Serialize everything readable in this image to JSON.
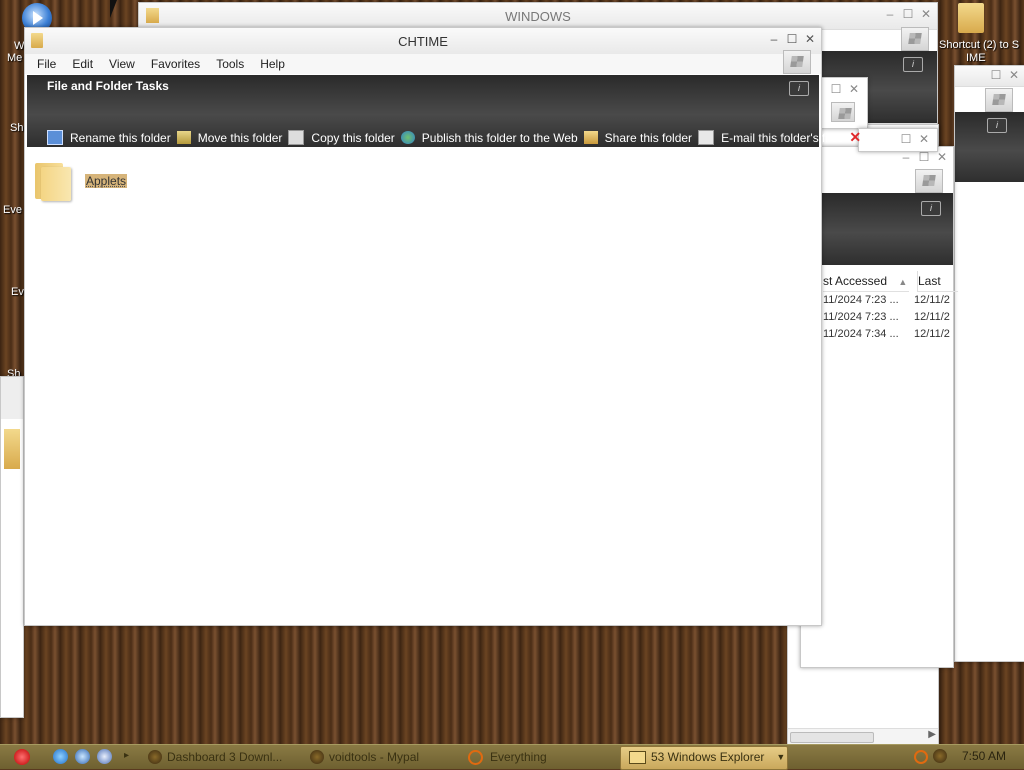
{
  "desktop": {
    "icons": [
      {
        "label": "Shortcut (2) to S",
        "label2": "IME"
      }
    ],
    "edge_labels": [
      "W",
      "Me",
      "Sh",
      "Eve",
      "Ev",
      "Sh"
    ]
  },
  "bg_windows": {
    "top_title": "WINDOWS",
    "columns": [
      {
        "label": "st Accessed"
      },
      {
        "label": "Last Ch"
      }
    ],
    "rows": [
      {
        "accessed": "11/2024 7:23 ...",
        "changed": "12/11/2"
      },
      {
        "accessed": "11/2024 7:23 ...",
        "changed": "12/11/2"
      },
      {
        "accessed": "11/2024 7:34 ...",
        "changed": "12/11/2"
      }
    ]
  },
  "window": {
    "title": "CHTIME",
    "menu": [
      "File",
      "Edit",
      "View",
      "Favorites",
      "Tools",
      "Help"
    ],
    "tasks_title": "File and Folder Tasks",
    "tasks": [
      {
        "label": "Rename this folder",
        "icon": "rename-icon"
      },
      {
        "label": "Move this folder",
        "icon": "move-icon"
      },
      {
        "label": "Copy this folder",
        "icon": "copy-icon"
      },
      {
        "label": "Publish this folder to the Web",
        "icon": "publish-icon"
      },
      {
        "label": "Share this folder",
        "icon": "share-icon"
      },
      {
        "label": "E-mail this folder's files",
        "icon": "email-icon"
      }
    ],
    "items": [
      {
        "name": "Applets",
        "type": "folder"
      }
    ]
  },
  "taskbar": {
    "items": [
      {
        "label": "Dashboard 3 Downl..."
      },
      {
        "label": "voidtools - Mypal"
      },
      {
        "label": "Everything"
      },
      {
        "label": "53 Windows Explorer"
      }
    ],
    "clock": "7:50 AM"
  },
  "colors": {
    "accent": "#d6b47a",
    "taskbar": "#7a6a38",
    "taskpane": "#3a3a3a"
  }
}
